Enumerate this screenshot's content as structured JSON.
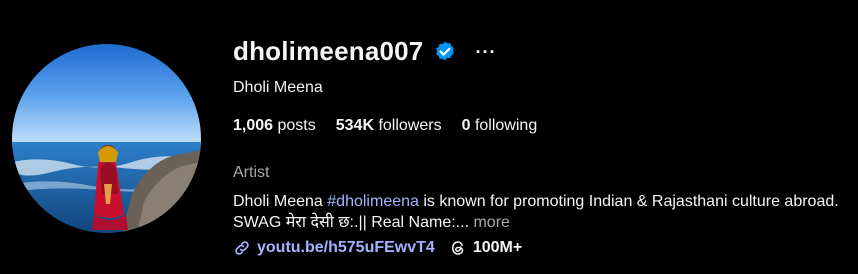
{
  "profile": {
    "username": "dholimeena007",
    "more_label": "···",
    "full_name": "Dholi Meena",
    "stats": {
      "posts_count": "1,006",
      "posts_label": "posts",
      "followers_count": "534K",
      "followers_label": "followers",
      "following_count": "0",
      "following_label": "following"
    },
    "category": "Artist",
    "bio": {
      "lead": "Dholi Meena ",
      "hashtag": "#dholimeena",
      "text": " is known for promoting Indian & Rajasthani culture abroad. SWAG मेरा देसी छ:.|| Real Name:...",
      "more_label": " more"
    },
    "link": {
      "icon": "link-icon",
      "url": "youtu.be/h575uFEwvT4"
    },
    "threads": {
      "icon": "threads-icon",
      "count": "100M+"
    }
  },
  "colors": {
    "background": "#000000",
    "text": "#f5f5f5",
    "secondary": "#a8a8a8",
    "accent_link": "#a4b3ff",
    "verified": "#0095f6"
  }
}
